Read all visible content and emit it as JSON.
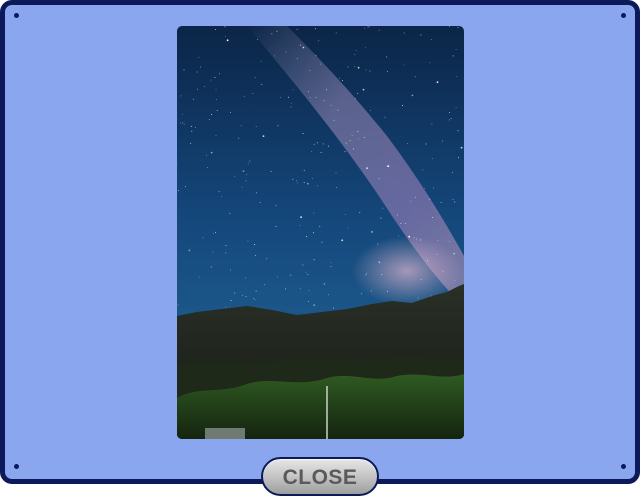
{
  "viewer": {
    "frame_color": "#0c1a5c",
    "background_color": "#8aa6ee",
    "close_label": "CLOSE"
  },
  "photo": {
    "subject": "milky-way-over-mountains",
    "sky_color": "#123a6e",
    "mountain_color": "#1c2318"
  }
}
